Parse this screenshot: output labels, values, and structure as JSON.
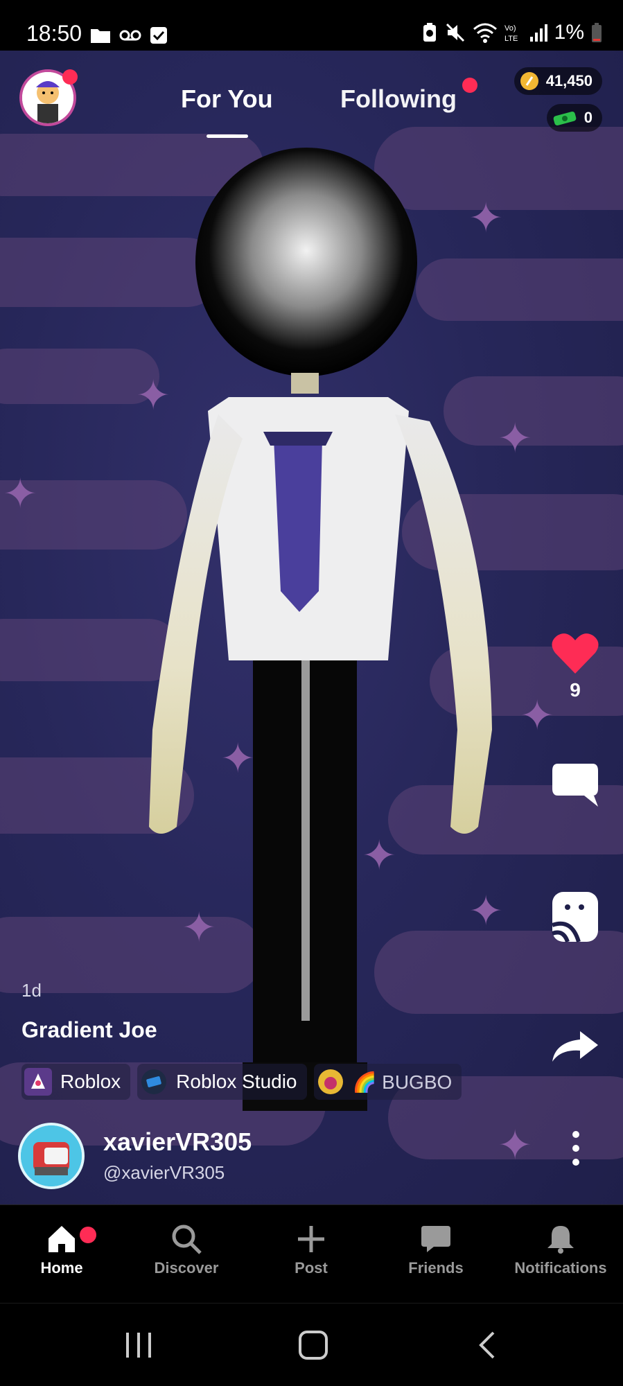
{
  "status_bar": {
    "time": "18:50",
    "battery_text": "1%",
    "icons": [
      "folder-icon",
      "voicemail-icon",
      "check-icon",
      "battery-saver-icon",
      "mute-icon",
      "wifi-icon",
      "volte-icon",
      "signal-icon",
      "battery-low-icon"
    ]
  },
  "header": {
    "tabs": [
      {
        "label": "For You",
        "active": true
      },
      {
        "label": "Following",
        "active": false,
        "has_dot": true
      }
    ],
    "coins": "41,450",
    "cash": "0"
  },
  "post": {
    "age": "1d",
    "title": "Gradient Joe",
    "tags": [
      {
        "label": "Roblox"
      },
      {
        "label": "Roblox Studio"
      },
      {
        "label": "🌈 BUGBO",
        "truncated": true
      }
    ],
    "likes": "9"
  },
  "creator": {
    "display_name": "xavierVR305",
    "handle": "@xavierVR305"
  },
  "bottom_nav": [
    {
      "label": "Home",
      "icon": "home-icon",
      "active": true
    },
    {
      "label": "Discover",
      "icon": "search-icon",
      "active": false
    },
    {
      "label": "Post",
      "icon": "plus-icon",
      "active": false
    },
    {
      "label": "Friends",
      "icon": "chat-icon",
      "active": false
    },
    {
      "label": "Notifications",
      "icon": "bell-icon",
      "active": false
    }
  ],
  "colors": {
    "accent": "#fe2c55",
    "background": "#000000",
    "sky": "#27275a",
    "cloud": "#5c4377"
  }
}
